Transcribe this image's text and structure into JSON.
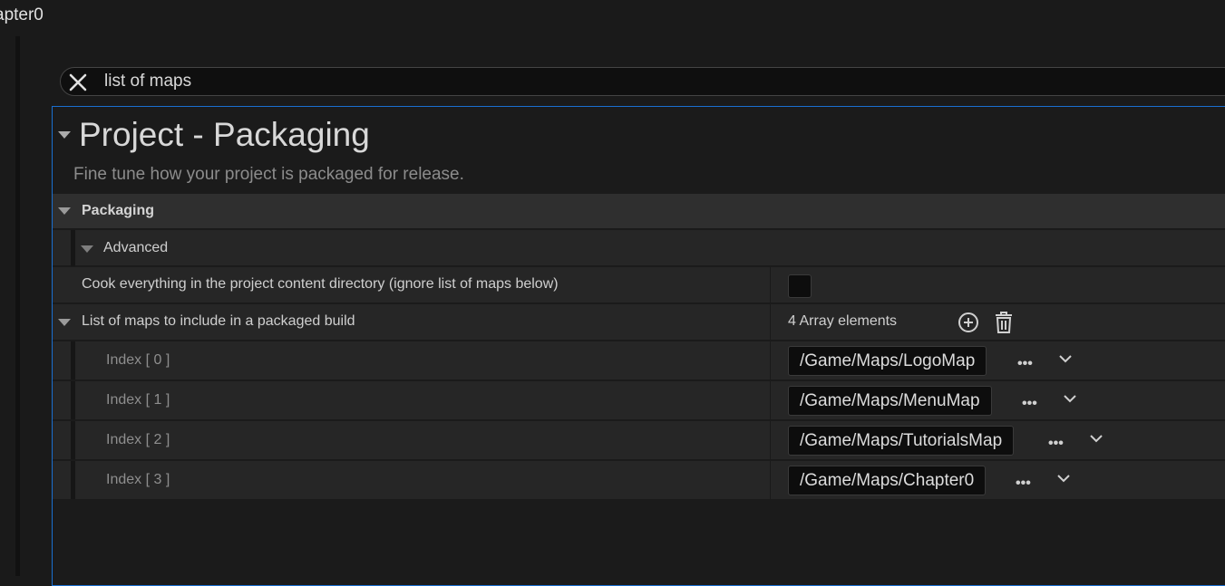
{
  "window": {
    "title_fragment": "apter0"
  },
  "search": {
    "value": "list of maps"
  },
  "section": {
    "title": "Project - Packaging",
    "subtitle": "Fine tune how your project is packaged for release."
  },
  "category": {
    "label": "Packaging"
  },
  "subcategory": {
    "label": "Advanced"
  },
  "properties": {
    "cook_everything": {
      "label": "Cook everything in the project content directory (ignore list of maps below)",
      "checked": false
    },
    "maps_list": {
      "label": "List of maps to include in a packaged build",
      "count_text": "4 Array elements",
      "items": [
        {
          "index": "Index [ 0 ]",
          "value": "/Game/Maps/LogoMap"
        },
        {
          "index": "Index [ 1 ]",
          "value": "/Game/Maps/MenuMap"
        },
        {
          "index": "Index [ 2 ]",
          "value": "/Game/Maps/TutorialsMap"
        },
        {
          "index": "Index [ 3 ]",
          "value": "/Game/Maps/Chapter0"
        }
      ]
    }
  },
  "icons": {
    "close": "close-icon",
    "add": "add-circle-icon",
    "trash": "trash-icon",
    "browse": "ellipsis-icon",
    "dropdown": "chevron-down-icon"
  },
  "colors": {
    "focus_border": "#1a6fd0",
    "background": "#1a1a1a"
  }
}
